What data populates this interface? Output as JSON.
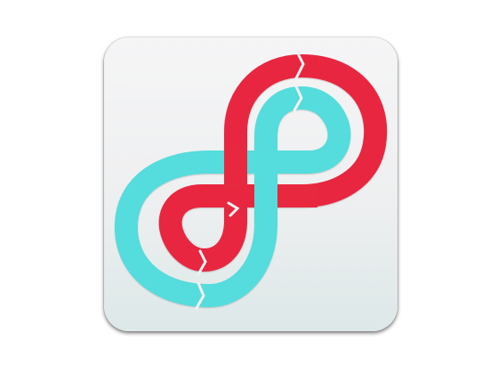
{
  "app_icon": {
    "icon": "infinity-loop-logo-icon",
    "colors": {
      "red": "#e8283f",
      "teal": "#55dcdc",
      "background_top": "#f5f5f6",
      "background_bottom": "#dde8e8",
      "gap": "#f2f2f3"
    }
  }
}
